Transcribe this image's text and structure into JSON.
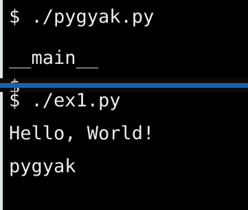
{
  "terminal": {
    "top_lines": [
      "$ ./pygyak.py",
      "__main__"
    ],
    "divider_prompt": "$",
    "bottom_lines": [
      "$ ./ex1.py",
      "Hello, World!",
      "pygyak"
    ]
  },
  "colors": {
    "background": "#000000",
    "text": "#ededed",
    "divider_bar": "#1a5fb4",
    "frame": "#dfe6e2"
  }
}
